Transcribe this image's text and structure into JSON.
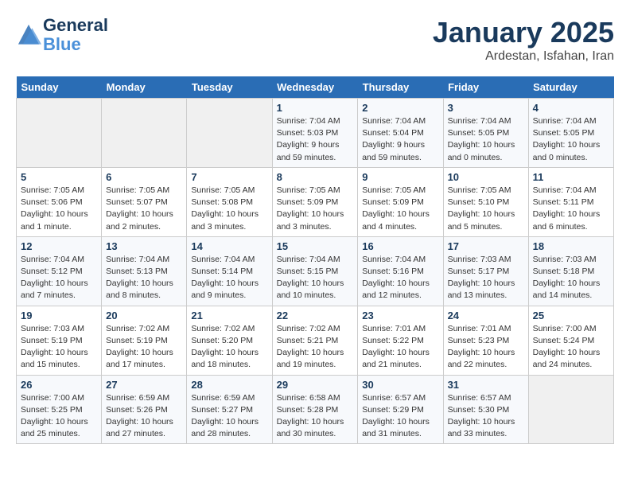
{
  "header": {
    "logo_line1": "General",
    "logo_line2": "Blue",
    "month": "January 2025",
    "location": "Ardestan, Isfahan, Iran"
  },
  "weekdays": [
    "Sunday",
    "Monday",
    "Tuesday",
    "Wednesday",
    "Thursday",
    "Friday",
    "Saturday"
  ],
  "weeks": [
    [
      {
        "day": "",
        "info": ""
      },
      {
        "day": "",
        "info": ""
      },
      {
        "day": "",
        "info": ""
      },
      {
        "day": "1",
        "info": "Sunrise: 7:04 AM\nSunset: 5:03 PM\nDaylight: 9 hours and 59 minutes."
      },
      {
        "day": "2",
        "info": "Sunrise: 7:04 AM\nSunset: 5:04 PM\nDaylight: 9 hours and 59 minutes."
      },
      {
        "day": "3",
        "info": "Sunrise: 7:04 AM\nSunset: 5:05 PM\nDaylight: 10 hours and 0 minutes."
      },
      {
        "day": "4",
        "info": "Sunrise: 7:04 AM\nSunset: 5:05 PM\nDaylight: 10 hours and 0 minutes."
      }
    ],
    [
      {
        "day": "5",
        "info": "Sunrise: 7:05 AM\nSunset: 5:06 PM\nDaylight: 10 hours and 1 minute."
      },
      {
        "day": "6",
        "info": "Sunrise: 7:05 AM\nSunset: 5:07 PM\nDaylight: 10 hours and 2 minutes."
      },
      {
        "day": "7",
        "info": "Sunrise: 7:05 AM\nSunset: 5:08 PM\nDaylight: 10 hours and 3 minutes."
      },
      {
        "day": "8",
        "info": "Sunrise: 7:05 AM\nSunset: 5:09 PM\nDaylight: 10 hours and 3 minutes."
      },
      {
        "day": "9",
        "info": "Sunrise: 7:05 AM\nSunset: 5:09 PM\nDaylight: 10 hours and 4 minutes."
      },
      {
        "day": "10",
        "info": "Sunrise: 7:05 AM\nSunset: 5:10 PM\nDaylight: 10 hours and 5 minutes."
      },
      {
        "day": "11",
        "info": "Sunrise: 7:04 AM\nSunset: 5:11 PM\nDaylight: 10 hours and 6 minutes."
      }
    ],
    [
      {
        "day": "12",
        "info": "Sunrise: 7:04 AM\nSunset: 5:12 PM\nDaylight: 10 hours and 7 minutes."
      },
      {
        "day": "13",
        "info": "Sunrise: 7:04 AM\nSunset: 5:13 PM\nDaylight: 10 hours and 8 minutes."
      },
      {
        "day": "14",
        "info": "Sunrise: 7:04 AM\nSunset: 5:14 PM\nDaylight: 10 hours and 9 minutes."
      },
      {
        "day": "15",
        "info": "Sunrise: 7:04 AM\nSunset: 5:15 PM\nDaylight: 10 hours and 10 minutes."
      },
      {
        "day": "16",
        "info": "Sunrise: 7:04 AM\nSunset: 5:16 PM\nDaylight: 10 hours and 12 minutes."
      },
      {
        "day": "17",
        "info": "Sunrise: 7:03 AM\nSunset: 5:17 PM\nDaylight: 10 hours and 13 minutes."
      },
      {
        "day": "18",
        "info": "Sunrise: 7:03 AM\nSunset: 5:18 PM\nDaylight: 10 hours and 14 minutes."
      }
    ],
    [
      {
        "day": "19",
        "info": "Sunrise: 7:03 AM\nSunset: 5:19 PM\nDaylight: 10 hours and 15 minutes."
      },
      {
        "day": "20",
        "info": "Sunrise: 7:02 AM\nSunset: 5:19 PM\nDaylight: 10 hours and 17 minutes."
      },
      {
        "day": "21",
        "info": "Sunrise: 7:02 AM\nSunset: 5:20 PM\nDaylight: 10 hours and 18 minutes."
      },
      {
        "day": "22",
        "info": "Sunrise: 7:02 AM\nSunset: 5:21 PM\nDaylight: 10 hours and 19 minutes."
      },
      {
        "day": "23",
        "info": "Sunrise: 7:01 AM\nSunset: 5:22 PM\nDaylight: 10 hours and 21 minutes."
      },
      {
        "day": "24",
        "info": "Sunrise: 7:01 AM\nSunset: 5:23 PM\nDaylight: 10 hours and 22 minutes."
      },
      {
        "day": "25",
        "info": "Sunrise: 7:00 AM\nSunset: 5:24 PM\nDaylight: 10 hours and 24 minutes."
      }
    ],
    [
      {
        "day": "26",
        "info": "Sunrise: 7:00 AM\nSunset: 5:25 PM\nDaylight: 10 hours and 25 minutes."
      },
      {
        "day": "27",
        "info": "Sunrise: 6:59 AM\nSunset: 5:26 PM\nDaylight: 10 hours and 27 minutes."
      },
      {
        "day": "28",
        "info": "Sunrise: 6:59 AM\nSunset: 5:27 PM\nDaylight: 10 hours and 28 minutes."
      },
      {
        "day": "29",
        "info": "Sunrise: 6:58 AM\nSunset: 5:28 PM\nDaylight: 10 hours and 30 minutes."
      },
      {
        "day": "30",
        "info": "Sunrise: 6:57 AM\nSunset: 5:29 PM\nDaylight: 10 hours and 31 minutes."
      },
      {
        "day": "31",
        "info": "Sunrise: 6:57 AM\nSunset: 5:30 PM\nDaylight: 10 hours and 33 minutes."
      },
      {
        "day": "",
        "info": ""
      }
    ]
  ]
}
